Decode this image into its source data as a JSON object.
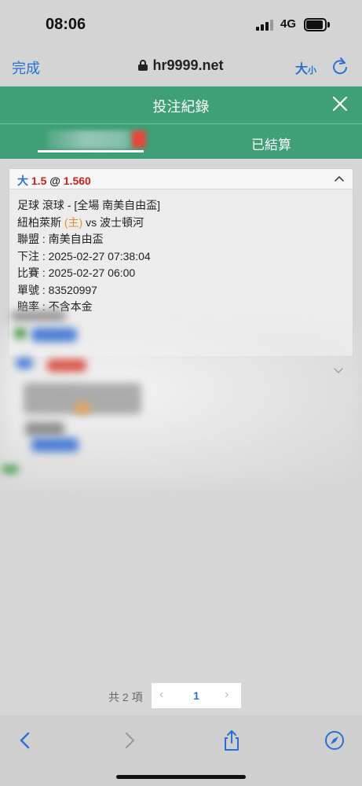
{
  "status_bar": {
    "time": "08:06",
    "network": "4G"
  },
  "browser": {
    "done_label": "完成",
    "url": "hr9999.net",
    "text_size_big": "大",
    "text_size_small": "小"
  },
  "header": {
    "title": "投注紀錄"
  },
  "tabs": {
    "settled_label": "已結算"
  },
  "bet": {
    "type": "大",
    "handicap": "1.5",
    "at": "@",
    "odds": "1.560",
    "sport_line": "足球 滾球 - [全場 南美自由盃]",
    "home_team": "紐柏萊斯",
    "home_tag": "(主)",
    "vs": "vs",
    "away_team": "波士頓河",
    "league_line": "聯盟 : 南美自由盃",
    "bet_time_line": "下注 : 2025-02-27 07:38:04",
    "match_time_line": "比賽 : 2025-02-27 06:00",
    "ticket_line": "單號 : 83520997",
    "odds_type_line": "賠率 : 不含本金"
  },
  "pagination": {
    "total": "共 2 項",
    "prev": "‹",
    "current": "1",
    "next": "›"
  },
  "colors": {
    "header_green": "#3f9f76",
    "accent_blue": "#2a6fd6",
    "odds_red": "#d0201a",
    "home_orange": "#e68a2e"
  },
  "icons": [
    "lock-icon",
    "reload-icon",
    "close-icon",
    "chevron-up-icon",
    "chevron-down-icon",
    "back-icon",
    "forward-icon",
    "share-icon",
    "compass-icon"
  ]
}
